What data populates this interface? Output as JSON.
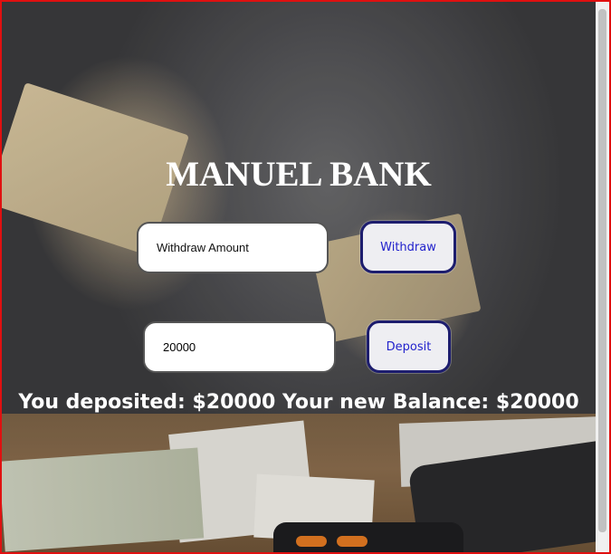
{
  "app": {
    "title": "MANUEL BANK"
  },
  "withdraw": {
    "placeholder": "Withdraw Amount",
    "value": "",
    "button_label": "Withdraw"
  },
  "deposit": {
    "placeholder": "",
    "value": "20000",
    "button_label": "Deposit"
  },
  "message": "You deposited: $20000 Your new Balance: $20000",
  "colors": {
    "frame_border": "#e01010",
    "button_text": "#2222cc",
    "button_border": "#1d1d6e",
    "title_text": "#ffffff"
  }
}
